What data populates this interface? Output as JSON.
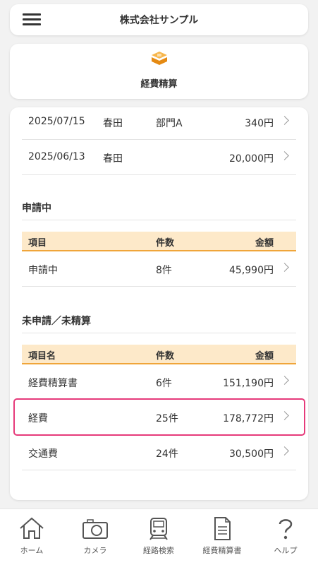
{
  "header": {
    "company": "株式会社サンプル"
  },
  "section": {
    "title": "経費精算",
    "icon": "expense-icon",
    "accent": "#f0a53a"
  },
  "recent_rows": [
    {
      "date": "2025/07/15",
      "name": "春田",
      "dept": "部門A",
      "amount": "340円"
    },
    {
      "date": "2025/06/13",
      "name": "春田",
      "dept": "",
      "amount": "20,000円"
    }
  ],
  "applying": {
    "heading": "申請中",
    "columns": [
      "項目",
      "件数",
      "金額"
    ],
    "rows": [
      {
        "item": "申請中",
        "count": "8件",
        "amount": "45,990円"
      }
    ]
  },
  "unsubmitted": {
    "heading": "未申請／未精算",
    "columns": [
      "項目名",
      "件数",
      "金額"
    ],
    "rows": [
      {
        "item": "経費精算書",
        "count": "6件",
        "amount": "151,190円"
      },
      {
        "item": "経費",
        "count": "25件",
        "amount": "178,772円",
        "highlighted": true
      },
      {
        "item": "交通費",
        "count": "24件",
        "amount": "30,500円"
      }
    ]
  },
  "highlight_color": "#e63a7a",
  "nav": [
    {
      "label": "ホーム",
      "icon": "home-icon"
    },
    {
      "label": "カメラ",
      "icon": "camera-icon"
    },
    {
      "label": "経路検索",
      "icon": "train-icon"
    },
    {
      "label": "経費精算書",
      "icon": "document-icon"
    },
    {
      "label": "ヘルプ",
      "icon": "help-icon"
    }
  ]
}
